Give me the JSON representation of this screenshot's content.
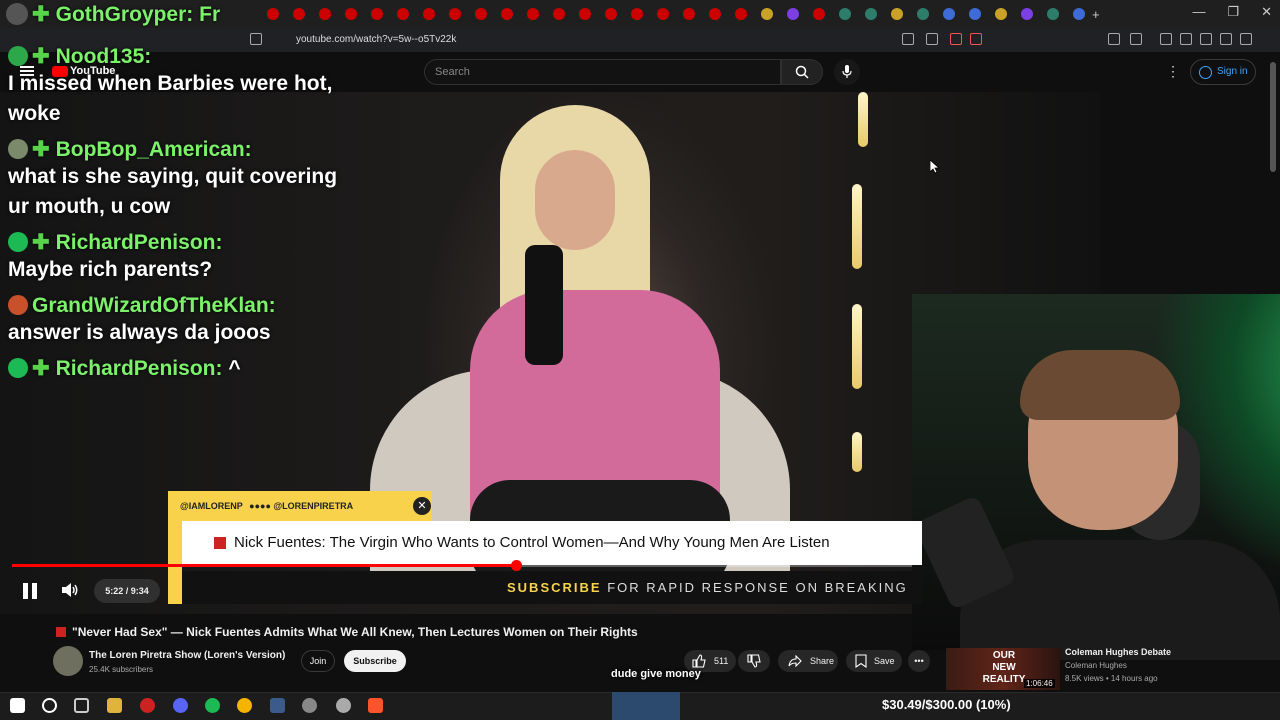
{
  "browser": {
    "url": "youtube.com/watch?v=5w--o5Tv22k",
    "win_minimize": "—",
    "win_restore": "❐",
    "win_close": "✕"
  },
  "youtube": {
    "logo": "YouTube",
    "search_placeholder": "Search",
    "signin": "Sign in"
  },
  "chat": {
    "top_user": "GothGroyper: Fr",
    "messages": [
      {
        "user": "Nood135:",
        "text": "I missed when Barbies were hot, woke"
      },
      {
        "user": "BopBop_American:",
        "text": "what is she saying, quit covering ur mouth, u cow"
      },
      {
        "user": "RichardPenison:",
        "text": "Maybe rich parents?"
      },
      {
        "user": "GrandWizardOfTheKlan:",
        "text": "answer is always da jooos"
      },
      {
        "user": "RichardPenison:",
        "text": "^"
      }
    ]
  },
  "lower_third": {
    "handles": "@IAMLORENP",
    "handle2": "@LORENPIRETRA",
    "headline": "Nick Fuentes: The Virgin Who Wants to Control Women—And Why Young Men Are Listen",
    "subscribe": "SUBSCRIBE",
    "subscribe_rest": "FOR RAPID RESPONSE ON BREAKING"
  },
  "player": {
    "time": "5:22 / 9:34",
    "progress": 0.56
  },
  "video": {
    "title": "\"Never Had Sex\" — Nick Fuentes Admits What We All Knew, Then Lectures Women on Their Rights",
    "channel": "The Loren Piretra Show (Loren's Version)",
    "subs": "25.4K subscribers",
    "join": "Join",
    "subscribe": "Subscribe",
    "likes": "511",
    "share": "Share",
    "save": "Save",
    "more": "•••"
  },
  "caption": "dude give money",
  "recommended": {
    "thumb_text": "OUR NEW REALITY",
    "duration": "1:06:46",
    "title": "Coleman Hughes Debate",
    "channel": "Coleman Hughes",
    "meta": "8.5K views • 14 hours ago"
  },
  "taskbar": {
    "goal": "$30.49/$300.00 (10%)"
  },
  "colors": {
    "chat_name": "#7cf26a",
    "accent_red": "#ff0000",
    "lower_third_yellow": "#f7d24a",
    "signin_blue": "#3ea6ff"
  }
}
